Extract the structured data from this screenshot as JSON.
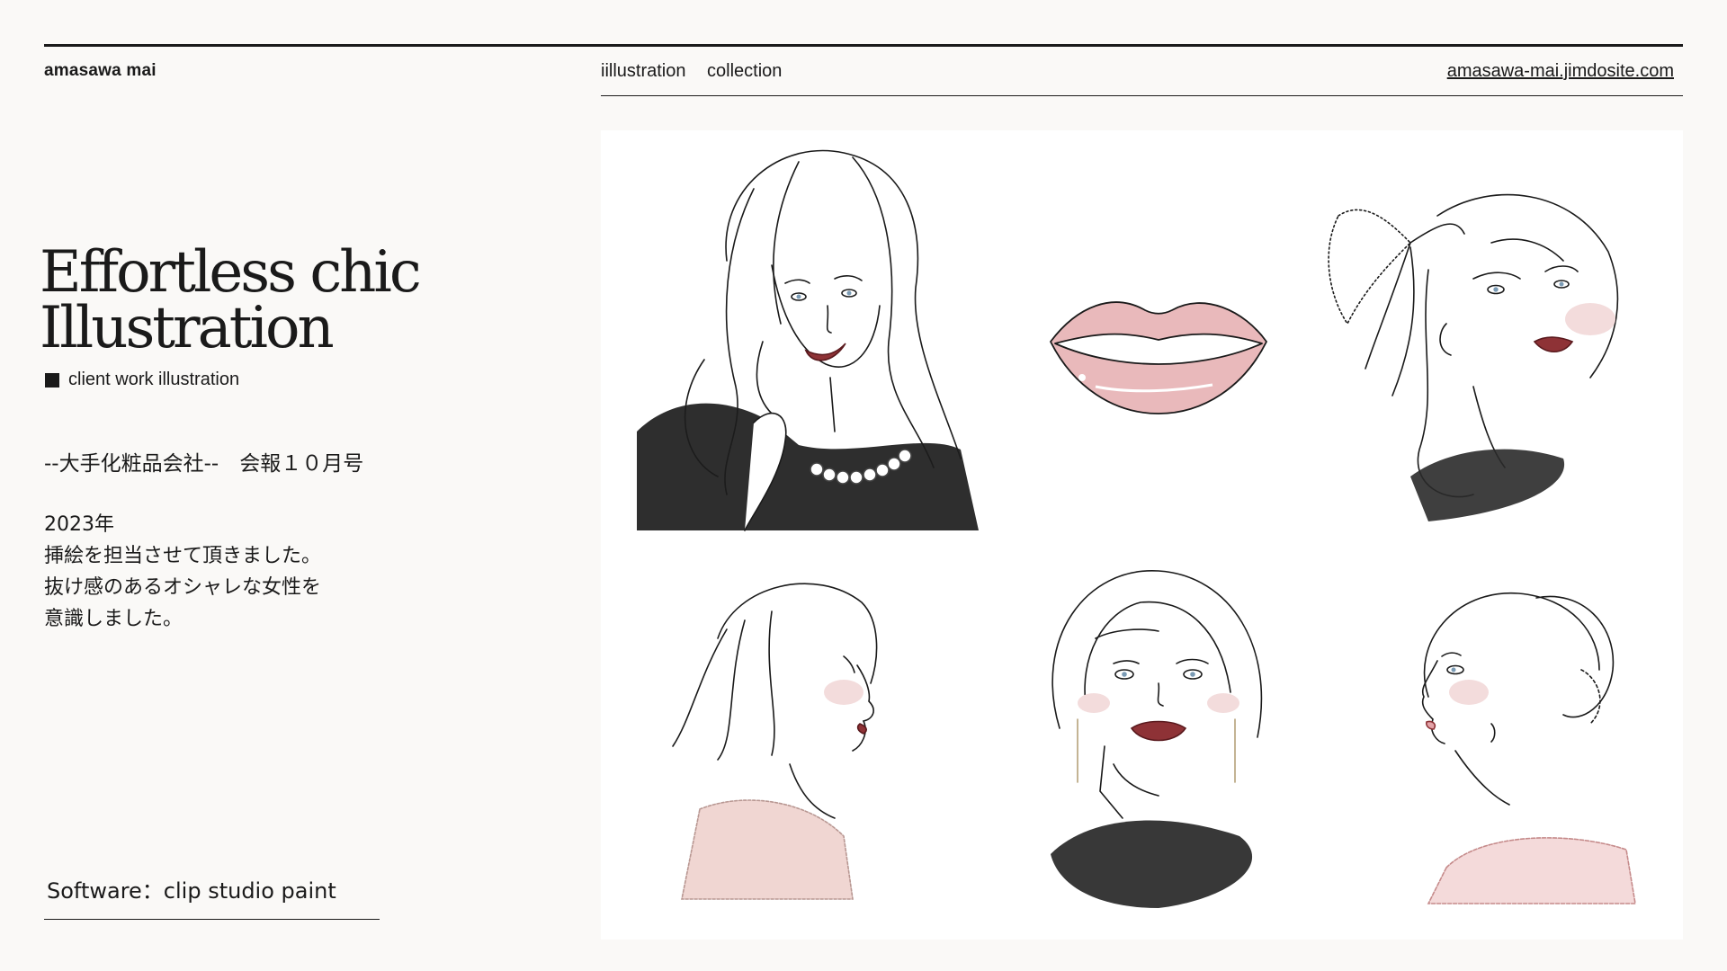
{
  "header": {
    "brand": "amasawa mai",
    "nav": [
      "iillustration",
      "collection"
    ],
    "site_link": "amasawa-mai.jimdosite.com"
  },
  "hero": {
    "title_line1": "Effortless chic",
    "title_line2": "Illustration",
    "subtitle": "client work illustration"
  },
  "details": {
    "client_line": "--大手化粧品会社--　会報１０月号",
    "description": [
      "2023年",
      "挿絵を担当させて頂きました。",
      "抜け感のあるオシャレな女性を",
      "意識しました。"
    ]
  },
  "footer": {
    "software": "Software：clip studio paint"
  },
  "gallery": {
    "items": [
      "woman-pearls",
      "lips",
      "woman-ribbon",
      "woman-profile-bob",
      "woman-hand-chin",
      "woman-profile-bun"
    ]
  },
  "colors": {
    "background": "#faf9f7",
    "text": "#1a1a1a",
    "lip_red": "#8e3236",
    "lip_pink": "#e9b9bb",
    "blush": "#f3dcdc"
  }
}
